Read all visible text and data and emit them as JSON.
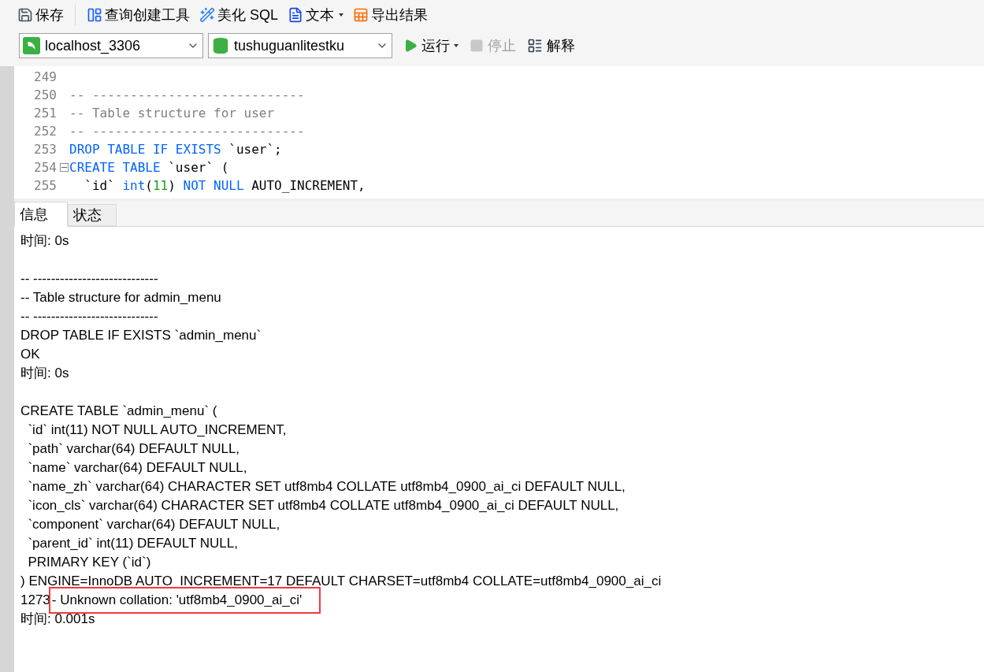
{
  "toolbar": [
    {
      "kind": "save",
      "label": "保存",
      "dropdown": false
    },
    {
      "kind": "builder",
      "label": "查询创建工具",
      "dropdown": false
    },
    {
      "kind": "beautify",
      "label": "美化 SQL",
      "dropdown": false
    },
    {
      "kind": "text",
      "label": "文本",
      "dropdown": true
    },
    {
      "kind": "export",
      "label": "导出结果",
      "dropdown": false
    }
  ],
  "connection": {
    "value": "localhost_3306"
  },
  "database": {
    "value": "tushuguanlitestku"
  },
  "actions": [
    {
      "kind": "run",
      "label": "运行",
      "dropdown": true,
      "disabled": false
    },
    {
      "kind": "stop",
      "label": "停止",
      "dropdown": false,
      "disabled": true
    },
    {
      "kind": "explain",
      "label": "解释",
      "dropdown": false,
      "disabled": false
    }
  ],
  "editor": {
    "lines": [
      {
        "number": "249",
        "fold": false
      },
      {
        "number": "250",
        "fold": false,
        "tokens": [
          {
            "kind": "comment",
            "text": "-- ----------------------------"
          }
        ]
      },
      {
        "number": "251",
        "fold": false,
        "tokens": [
          {
            "kind": "comment",
            "text": "-- Table structure for user"
          }
        ]
      },
      {
        "number": "252",
        "fold": false,
        "tokens": [
          {
            "kind": "comment",
            "text": "-- ----------------------------"
          }
        ]
      },
      {
        "number": "253",
        "fold": false,
        "tokens": [
          {
            "kind": "keyword",
            "text": "DROP TABLE IF EXISTS"
          },
          {
            "kind": "plain",
            "text": " `user`;"
          }
        ]
      },
      {
        "number": "254",
        "fold": true,
        "tokens": [
          {
            "kind": "keyword",
            "text": "CREATE TABLE"
          },
          {
            "kind": "plain",
            "text": " `user` ("
          }
        ]
      },
      {
        "number": "255",
        "fold": false,
        "tokens": [
          {
            "kind": "plain",
            "text": "  `id` "
          },
          {
            "kind": "keyword",
            "text": "int"
          },
          {
            "kind": "plain",
            "text": "("
          },
          {
            "kind": "number",
            "text": "11"
          },
          {
            "kind": "plain",
            "text": ") "
          },
          {
            "kind": "keyword",
            "text": "NOT NULL"
          },
          {
            "kind": "plain",
            "text": " AUTO_INCREMENT,"
          }
        ]
      }
    ]
  },
  "tabs": [
    {
      "label": "信息",
      "selected": true
    },
    {
      "label": "状态",
      "selected": false
    }
  ],
  "log": {
    "blocks": [
      {
        "lines": [
          {
            "text": "时间: 0s"
          }
        ]
      },
      {
        "lines": [
          {
            "text": "-- ----------------------------"
          },
          {
            "text": "-- Table structure for admin_menu"
          },
          {
            "text": "-- ----------------------------"
          },
          {
            "text": "DROP TABLE IF EXISTS `admin_menu`"
          },
          {
            "text": "OK"
          },
          {
            "text": "时间: 0s"
          }
        ]
      },
      {
        "lines": [
          {
            "text": "CREATE TABLE `admin_menu` ("
          },
          {
            "text": "  `id` int(11) NOT NULL AUTO_INCREMENT,"
          },
          {
            "text": "  `path` varchar(64) DEFAULT NULL,"
          },
          {
            "text": "  `name` varchar(64) DEFAULT NULL,"
          },
          {
            "text": "  `name_zh` varchar(64) CHARACTER SET utf8mb4 COLLATE utf8mb4_0900_ai_ci DEFAULT NULL,"
          },
          {
            "text": "  `icon_cls` varchar(64) CHARACTER SET utf8mb4 COLLATE utf8mb4_0900_ai_ci DEFAULT NULL,"
          },
          {
            "text": "  `component` varchar(64) DEFAULT NULL,"
          },
          {
            "text": "  `parent_id` int(11) DEFAULT NULL,"
          },
          {
            "text": "  PRIMARY KEY (`id`)"
          },
          {
            "text": ") ENGINE=InnoDB AUTO_INCREMENT=17 DEFAULT CHARSET=utf8mb4 COLLATE=utf8mb4_0900_ai_ci"
          },
          {
            "code": "1273",
            "text": "- Unknown collation: 'utf8mb4_0900_ai_ci'",
            "highlighted": true
          },
          {
            "text": "时间: 0.001s"
          }
        ]
      }
    ]
  }
}
